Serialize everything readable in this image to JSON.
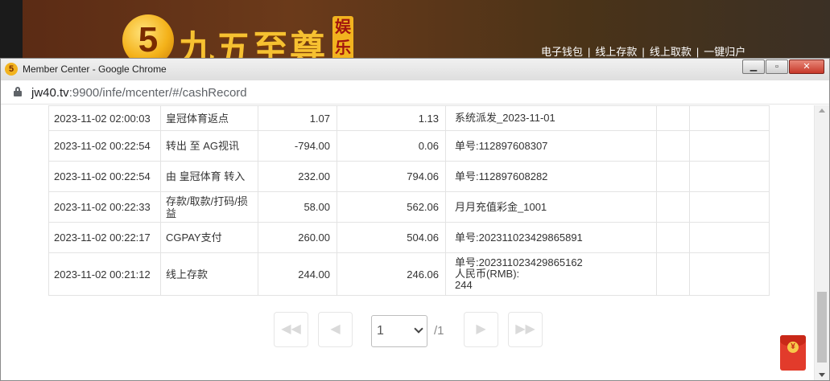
{
  "site": {
    "logo_symbol": "5",
    "logo_name": "九五至尊",
    "logo_tag": "娱乐",
    "nav": [
      "电子钱包",
      "线上存款",
      "线上取款",
      "一键归户"
    ],
    "nav_sep": "|"
  },
  "window": {
    "icon_symbol": "5",
    "title": "Member Center - Google Chrome",
    "minimize_glyph": "▁",
    "maximize_glyph": "▫",
    "close_glyph": "✕"
  },
  "address_bar": {
    "host": "jw40.tv",
    "path": ":9900/infe/mcenter/#/cashRecord"
  },
  "records": [
    {
      "date": "2023-11-02 02:00:03",
      "type": "皇冠体育返点",
      "amount": "1.07",
      "balance": "1.13",
      "note": [
        "系统派发_2023-11-01"
      ]
    },
    {
      "date": "2023-11-02 00:22:54",
      "type": "转出 至 AG视讯",
      "amount": "-794.00",
      "balance": "0.06",
      "note": [
        "单号:112897608307"
      ]
    },
    {
      "date": "2023-11-02 00:22:54",
      "type": "由 皇冠体育 转入",
      "amount": "232.00",
      "balance": "794.06",
      "note": [
        "单号:112897608282"
      ]
    },
    {
      "date": "2023-11-02 00:22:33",
      "type": "存款/取款/打码/损益",
      "amount": "58.00",
      "balance": "562.06",
      "note": [
        "月月充值彩金_1001"
      ]
    },
    {
      "date": "2023-11-02 00:22:17",
      "type": "CGPAY支付",
      "amount": "260.00",
      "balance": "504.06",
      "note": [
        "单号:202311023429865891"
      ]
    },
    {
      "date": "2023-11-02 00:21:12",
      "type": "线上存款",
      "amount": "244.00",
      "balance": "246.06",
      "note": [
        "单号:202311023429865162",
        "人民币(RMB):",
        "244"
      ]
    }
  ],
  "pagination": {
    "first_glyph": "◀◀",
    "prev_glyph": "◀",
    "current_page": "1",
    "total": "/1",
    "next_glyph": "▶",
    "last_glyph": "▶▶"
  },
  "floating": {
    "redpacket_coin": "¥"
  }
}
